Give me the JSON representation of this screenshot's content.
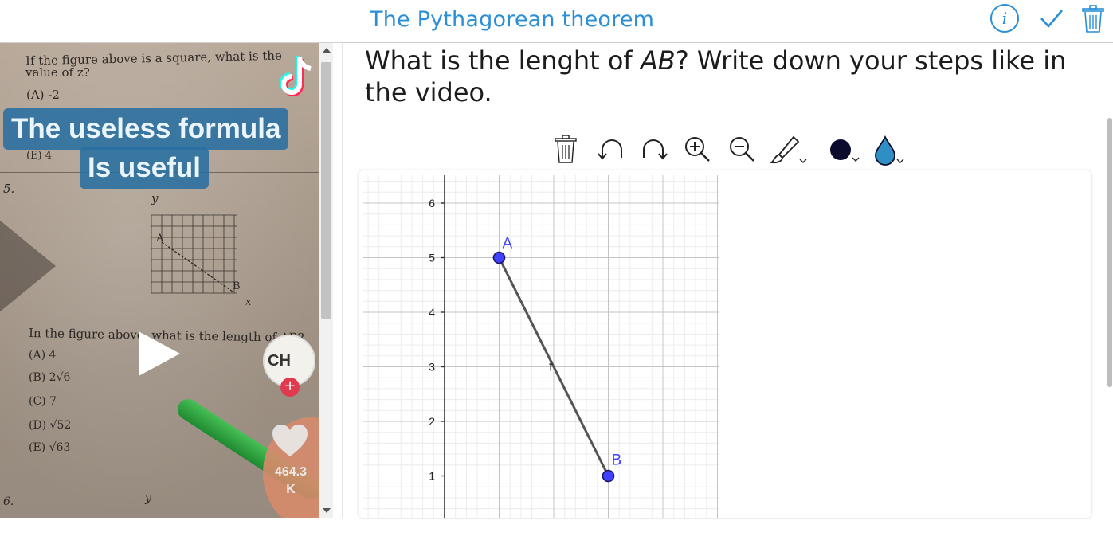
{
  "header": {
    "title": "The Pythagorean theorem",
    "info_label": "i",
    "accent_color": "#2a8fd6"
  },
  "video": {
    "problem1_line1": "If the figure above is a square, what is the",
    "problem1_line2": "value of z?",
    "option_a1": "(A) -2",
    "option_e1": "(E)   4",
    "caption1": "The useless formula",
    "caption2": "Is useful",
    "number5": "5.",
    "axis_y": "y",
    "mini_label_a": "A",
    "mini_label_b": "B",
    "mini_axis_x": "x",
    "problem2_line": "In the figure above, what is the length of AB?",
    "options": [
      "(A) 4",
      "(B) 2√6",
      "(C) 7",
      "(D) √52",
      "(E) √63"
    ],
    "number6": "6.",
    "axis_y2": "y",
    "avatar_text": "CH",
    "like_count": "464.3\nK",
    "like_count_line1": "464.3",
    "like_count_line2": "K"
  },
  "question": {
    "text_before": "What is the lenght of ",
    "ab": "AB",
    "text_after": "? Write down your steps like in the video."
  },
  "toolbar": {
    "icons": [
      "trash-icon",
      "undo-icon",
      "redo-icon",
      "zoom-in-icon",
      "zoom-out-icon",
      "brush-icon",
      "color-icon",
      "opacity-icon"
    ],
    "pen_color": "#0b0b2e",
    "fill_color": "#2f8fc4"
  },
  "chart_data": {
    "type": "scatter",
    "y_ticks": [
      "1",
      "2",
      "3",
      "4",
      "5",
      "6"
    ],
    "points": [
      {
        "name": "A",
        "x": 1,
        "y": 5
      },
      {
        "name": "B",
        "x": 3,
        "y": 1
      }
    ],
    "segment_label": "f",
    "grid": true,
    "point_color": "#4040ff"
  }
}
